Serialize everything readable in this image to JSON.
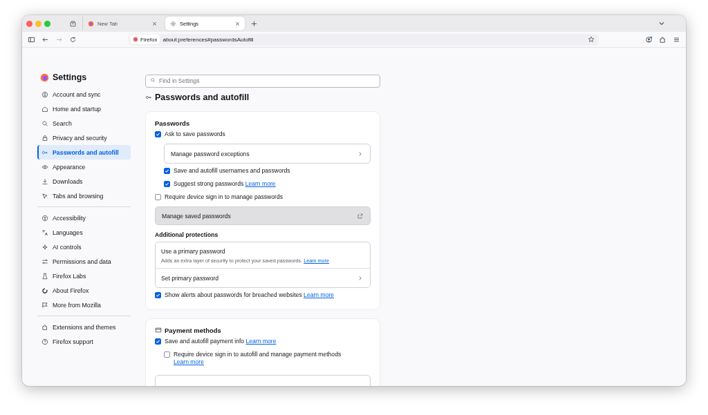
{
  "window": {
    "tabs": [
      {
        "label": "New Tab",
        "selected": false
      },
      {
        "label": "Settings",
        "selected": true
      }
    ]
  },
  "toolbar": {
    "identity_label": "Firefox",
    "url": "about:preferences#passwordsAutofill",
    "forward_disabled": true
  },
  "sidebar": {
    "title": "Settings",
    "groups": [
      {
        "items": [
          {
            "label": "Account and sync",
            "selected": false
          },
          {
            "label": "Home and startup",
            "selected": false
          },
          {
            "label": "Search",
            "selected": false
          },
          {
            "label": "Privacy and security",
            "selected": false
          },
          {
            "label": "Passwords and autofill",
            "selected": true
          },
          {
            "label": "Appearance",
            "selected": false
          },
          {
            "label": "Downloads",
            "selected": false
          },
          {
            "label": "Tabs and browsing",
            "selected": false
          }
        ]
      },
      {
        "items": [
          {
            "label": "Accessibility",
            "selected": false
          },
          {
            "label": "Languages",
            "selected": false
          },
          {
            "label": "AI controls",
            "selected": false
          },
          {
            "label": "Permissions and data",
            "selected": false
          },
          {
            "label": "Firefox Labs",
            "selected": false
          },
          {
            "label": "About Firefox",
            "selected": false
          },
          {
            "label": "More from Mozilla",
            "selected": false
          }
        ]
      },
      {
        "items": [
          {
            "label": "Extensions and themes",
            "selected": false
          },
          {
            "label": "Firefox support",
            "selected": false
          }
        ]
      }
    ]
  },
  "search": {
    "placeholder": "Find in Settings"
  },
  "page_title": "Passwords and autofill",
  "cards": [
    {
      "heading": "Passwords",
      "rows": [
        {
          "kind": "checkbox",
          "label": "Ask to save passwords",
          "checked": true,
          "children": [
            {
              "kind": "nav-button",
              "label": "Manage password exceptions"
            },
            {
              "kind": "checkbox",
              "label": "Save and autofill usernames and passwords",
              "checked": true
            },
            {
              "kind": "checkbox",
              "label": "Suggest strong passwords",
              "link": "Learn more",
              "checked": true
            }
          ]
        },
        {
          "kind": "checkbox",
          "label": "Require device sign in to manage passwords",
          "checked": false
        },
        {
          "kind": "external-button",
          "label": "Manage saved passwords"
        },
        {
          "kind": "subheading",
          "label": "Additional protections"
        },
        {
          "kind": "box",
          "title": "Use a primary password",
          "description": "Adds an extra layer of security to protect your saved passwords.",
          "link": "Learn more",
          "action": "Set primary password"
        },
        {
          "kind": "checkbox",
          "label": "Show alerts about passwords for breached websites",
          "link": "Learn more",
          "checked": true
        }
      ]
    },
    {
      "heading": "Payment methods",
      "kind": "payment",
      "rows": [
        {
          "kind": "checkbox",
          "label": "Save and autofill payment info",
          "link": "Learn more",
          "checked": true,
          "children": [
            {
              "kind": "checkbox",
              "label": "Require device sign in to autofill and manage payment methods",
              "link": "Learn more",
              "checked": false
            }
          ]
        },
        {
          "kind": "nav-button"
        }
      ]
    }
  ]
}
